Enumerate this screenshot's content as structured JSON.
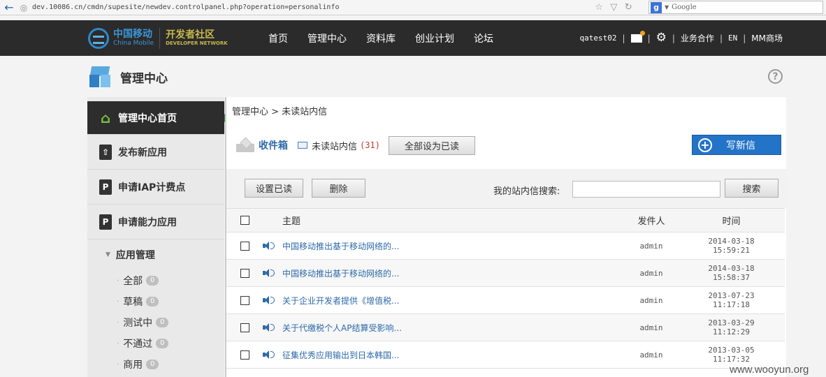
{
  "browser": {
    "url": "dev.10086.cn/cmdn/supesite/newdev.controlpanel.php?operation=personalinfo",
    "search_placeholder": "Google"
  },
  "topnav": {
    "logo_cn": "中国移动",
    "logo_en": "China Mobile",
    "logo_dev_cn": "开发者社区",
    "logo_dev_en": "DEVELOPER NETWORK",
    "menu": [
      "首页",
      "管理中心",
      "资料库",
      "创业计划",
      "论坛"
    ],
    "username": "qatest02",
    "business": "业务合作",
    "lang": "EN",
    "mm": "MM商场"
  },
  "page": {
    "title": "管理中心",
    "help": "?"
  },
  "sidebar": {
    "items": [
      {
        "label": "管理中心首页",
        "icon": "home-icon"
      },
      {
        "label": "发布新应用",
        "icon": "upload-icon"
      },
      {
        "label": "申请IAP计费点",
        "icon": "parking-icon"
      },
      {
        "label": "申请能力应用",
        "icon": "parking-icon"
      }
    ],
    "app_mgmt": "应用管理",
    "links": [
      {
        "label": "全部",
        "count": "0"
      },
      {
        "label": "草稿",
        "count": "0"
      },
      {
        "label": "测试中",
        "count": "0"
      },
      {
        "label": "不通过",
        "count": "0"
      },
      {
        "label": "商用",
        "count": "0"
      }
    ]
  },
  "main": {
    "breadcrumb": "管理中心 > 未读站内信",
    "inbox_label": "收件箱",
    "unread_label": "未读站内信",
    "unread_count": "(31)",
    "mark_all_read": "全部设为已读",
    "compose": "写新信",
    "set_read": "设置已读",
    "delete": "删除",
    "search_label": "我的站内信搜索:",
    "search_button": "搜索",
    "search_value": "",
    "columns": {
      "subject": "主题",
      "sender": "发件人",
      "time": "时间"
    },
    "rows": [
      {
        "subject": "中国移动推出基于移动网络的...",
        "sender": "admin",
        "time": "2014-03-18 15:59:21"
      },
      {
        "subject": "中国移动推出基于移动网络的...",
        "sender": "admin",
        "time": "2014-03-18 15:58:37"
      },
      {
        "subject": "关于企业开发者提供《增值税...",
        "sender": "admin",
        "time": "2013-07-23 11:17:18"
      },
      {
        "subject": "关于代缴税个人AP结算受影响...",
        "sender": "admin",
        "time": "2013-03-29 11:12:29"
      },
      {
        "subject": "征集优秀应用输出到日本韩国...",
        "sender": "admin",
        "time": "2013-03-05 11:17:32"
      }
    ]
  },
  "watermark": "www.wooyun.org"
}
